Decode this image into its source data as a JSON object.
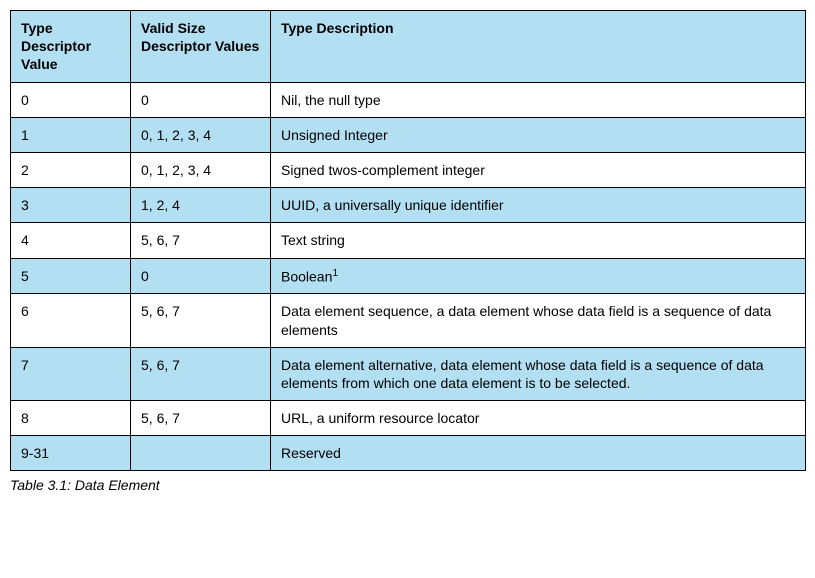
{
  "table": {
    "headers": {
      "col1": "Type Descriptor Value",
      "col2": "Valid Size Descriptor Values",
      "col3": "Type Description"
    },
    "rows": [
      {
        "value": "0",
        "sizes": "0",
        "desc": "Nil, the null type"
      },
      {
        "value": "1",
        "sizes": "0, 1, 2, 3, 4",
        "desc": "Unsigned Integer"
      },
      {
        "value": "2",
        "sizes": "0, 1, 2, 3, 4",
        "desc": "Signed twos-complement integer"
      },
      {
        "value": "3",
        "sizes": "1, 2, 4",
        "desc": "UUID, a universally unique identifier"
      },
      {
        "value": "4",
        "sizes": "5, 6, 7",
        "desc": "Text string"
      },
      {
        "value": "5",
        "sizes": "0",
        "desc": "Boolean",
        "sup": "1"
      },
      {
        "value": "6",
        "sizes": "5, 6, 7",
        "desc": "Data element sequence, a data element whose data field is a sequence of data elements"
      },
      {
        "value": "7",
        "sizes": "5, 6, 7",
        "desc": "Data element alternative, data element whose data field is a sequence of data elements from which one data element is to be selected."
      },
      {
        "value": "8",
        "sizes": "5, 6, 7",
        "desc": "URL, a uniform resource locator"
      },
      {
        "value": "9-31",
        "sizes": "",
        "desc": "Reserved"
      }
    ],
    "caption": "Table 3.1:  Data Element"
  }
}
